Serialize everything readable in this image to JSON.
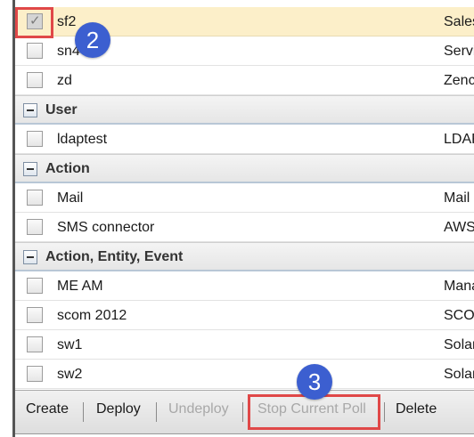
{
  "rows": [
    {
      "name": "sf2",
      "type": "Sales",
      "checked": true,
      "selected": true
    },
    {
      "name": "sn4",
      "type": "Servi",
      "checked": false
    },
    {
      "name": "zd",
      "type": "Zenc",
      "checked": false
    },
    {
      "name": "ldaptest",
      "type": "LDAF",
      "checked": false
    },
    {
      "name": "Mail",
      "type": "Mail",
      "checked": false
    },
    {
      "name": "SMS connector",
      "type": "AWS",
      "checked": false
    },
    {
      "name": "ME AM",
      "type": "Mana",
      "checked": false
    },
    {
      "name": "scom 2012",
      "type": "SCO",
      "checked": false
    },
    {
      "name": "sw1",
      "type": "Solar",
      "checked": false
    },
    {
      "name": "sw2",
      "type": "Solar",
      "checked": false
    }
  ],
  "groups": [
    {
      "name": "User"
    },
    {
      "name": "Action"
    },
    {
      "name": "Action, Entity, Event"
    }
  ],
  "toolbar": {
    "create": "Create",
    "deploy": "Deploy",
    "undeploy": "Undeploy",
    "stop_current_poll": "Stop Current Poll",
    "delete": "Delete"
  },
  "annotations": {
    "step2": "2",
    "step3": "3"
  },
  "icons": {
    "checkbox_tick": "✓"
  },
  "colors": {
    "selected_row": "#fcefc9",
    "highlight": "#e04848",
    "step_badge": "#3c5fd0"
  }
}
